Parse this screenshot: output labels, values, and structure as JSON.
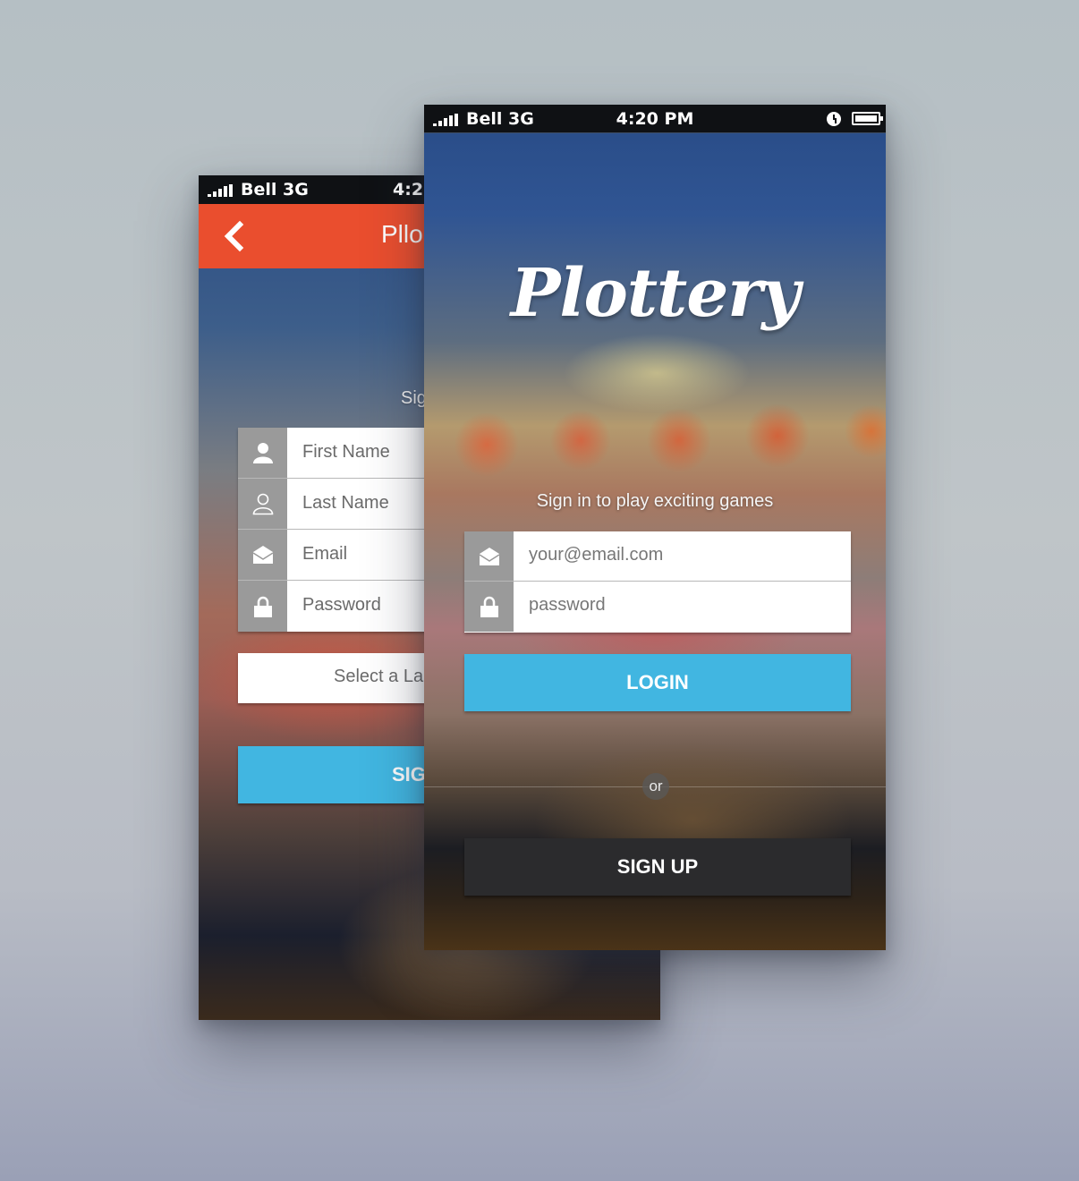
{
  "status_bar": {
    "carrier": "Bell 3G",
    "time": "4:20 PM",
    "time_partial": "4:2"
  },
  "signup_screen": {
    "nav_title_partial": "Pllo",
    "subtitle_partial": "Sig",
    "fields": [
      {
        "label": "First Name",
        "icon": "user-solid-icon"
      },
      {
        "label": "Last Name",
        "icon": "user-outline-icon"
      },
      {
        "label": "Email",
        "icon": "envelope-icon"
      },
      {
        "label": "Password",
        "icon": "lock-icon"
      }
    ],
    "language_select_partial": "Select a Lar",
    "signup_button_partial": "SIG"
  },
  "login_screen": {
    "logo": "Plottery",
    "tagline": "Sign in to play exciting games",
    "email_placeholder": "your@email.com",
    "password_placeholder": "password",
    "login_label": "LOGIN",
    "or_label": "or",
    "signup_label": "SIGN UP"
  },
  "colors": {
    "nav_orange": "#ea4e2e",
    "login_blue": "#41b6e1",
    "signup_dark": "#2b2b2d",
    "icon_gray": "#9a9a9a"
  }
}
